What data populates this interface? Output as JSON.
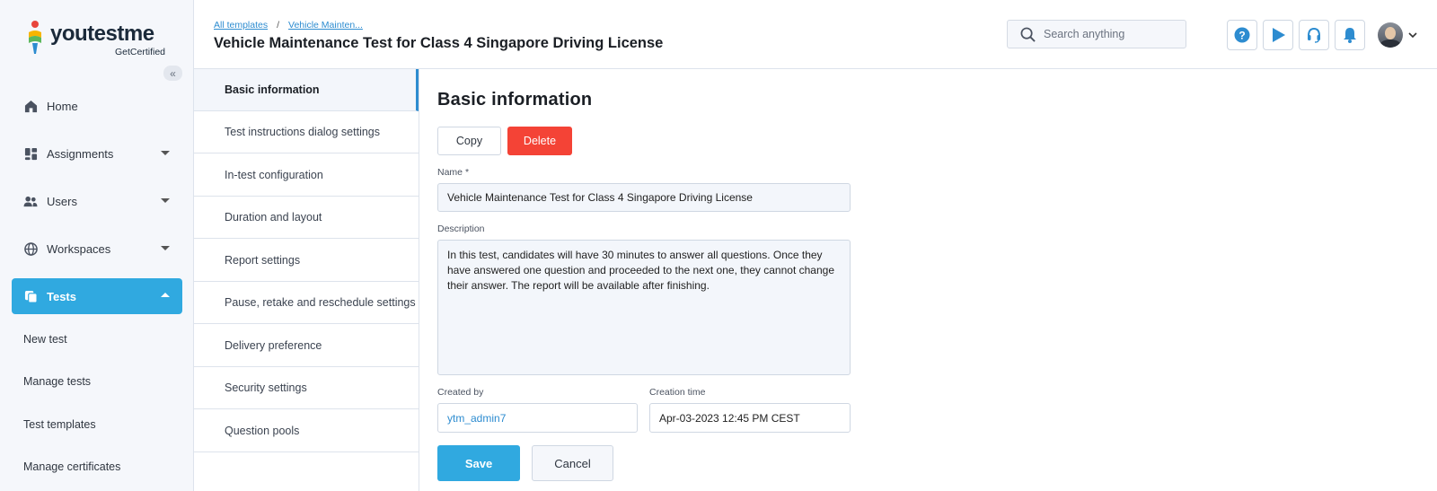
{
  "brand": {
    "name": "youtestme",
    "sub": "GetCertified",
    "colors": {
      "accent": "#30a9e0",
      "danger": "#f44336",
      "link": "#2d8cd0"
    }
  },
  "sidebar": {
    "collapse_icon": "double-chevron-left-icon",
    "items": [
      {
        "label": "Home",
        "icon": "home-icon"
      },
      {
        "label": "Assignments",
        "icon": "dashboard-icon"
      },
      {
        "label": "Users",
        "icon": "users-icon"
      },
      {
        "label": "Workspaces",
        "icon": "globe-icon"
      },
      {
        "label": "Tests",
        "icon": "tests-icon"
      }
    ],
    "sub_items": [
      "New test",
      "Manage tests",
      "Test templates",
      "Manage certificates"
    ]
  },
  "header": {
    "breadcrumb": [
      "All templates",
      "Vehicle Mainten..."
    ],
    "title": "Vehicle Maintenance Test for Class 4 Singapore Driving License",
    "search_placeholder": "Search anything",
    "buttons": [
      "help-icon",
      "play-icon",
      "headset-icon",
      "bell-icon"
    ]
  },
  "subnav": {
    "items": [
      "Basic information",
      "Test instructions dialog settings",
      "In-test configuration",
      "Duration and layout",
      "Report settings",
      "Pause, retake and reschedule settings",
      "Delivery preference",
      "Security settings",
      "Question pools"
    ]
  },
  "form": {
    "section_title": "Basic information",
    "copy_label": "Copy",
    "delete_label": "Delete",
    "name_label": "Name",
    "required_mark": "*",
    "name_value": "Vehicle Maintenance Test for Class 4 Singapore Driving License",
    "description_label": "Description",
    "description_value": "In this test, candidates will have 30 minutes to answer all questions. Once they have answered one question and proceeded to the next one, they cannot change their answer. The report will be available after finishing.",
    "created_by_label": "Created by",
    "created_by_value": "ytm_admin7",
    "creation_time_label": "Creation time",
    "creation_time_value": "Apr-03-2023 12:45 PM CEST",
    "save_label": "Save",
    "cancel_label": "Cancel"
  }
}
